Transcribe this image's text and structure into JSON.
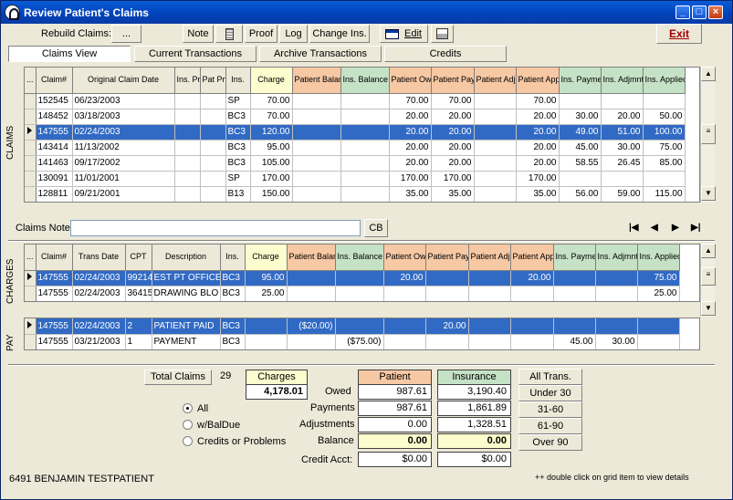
{
  "window": {
    "title": "Review Patient's Claims"
  },
  "toolbar": {
    "rebuild_label": "Rebuild Claims:",
    "rebuild_button": "...",
    "note": "Note",
    "proof": "Proof",
    "log": "Log",
    "change_ins": "Change Ins.",
    "edit": "Edit",
    "exit": "Exit"
  },
  "tabs": [
    "Claims View",
    "Current Transactions",
    "Archive Transactions",
    "Credits"
  ],
  "side_labels": {
    "claims": "CLAIMS",
    "charges": "CHARGES",
    "pay": "PAY"
  },
  "claims": {
    "headers": [
      "...",
      "Claim#",
      "Original Claim Date",
      "Ins. Prf",
      "Pat Prf",
      "Ins.",
      "Charge",
      "Patient Balance",
      "Ins. Balance",
      "Patient Owed",
      "Patient Payment",
      "Patient Adjmnt",
      "Patient Applied",
      "Ins. Payment",
      "Ins. Adjmnt",
      "Ins. Applied"
    ],
    "rows": [
      [
        "",
        "152545",
        "06/23/2003",
        "",
        "",
        "SP",
        "70.00",
        "",
        "",
        "70.00",
        "70.00",
        "",
        "70.00",
        "",
        "",
        ""
      ],
      [
        "",
        "148452",
        "03/18/2003",
        "",
        "",
        "BC3",
        "70.00",
        "",
        "",
        "20.00",
        "20.00",
        "",
        "20.00",
        "30.00",
        "20.00",
        "50.00"
      ],
      [
        "sel",
        "147555",
        "02/24/2003",
        "",
        "",
        "BC3",
        "120.00",
        "",
        "",
        "20.00",
        "20.00",
        "",
        "20.00",
        "49.00",
        "51.00",
        "100.00"
      ],
      [
        "",
        "143414",
        "11/13/2002",
        "",
        "",
        "BC3",
        "95.00",
        "",
        "",
        "20.00",
        "20.00",
        "",
        "20.00",
        "45.00",
        "30.00",
        "75.00"
      ],
      [
        "",
        "141463",
        "09/17/2002",
        "",
        "",
        "BC3",
        "105.00",
        "",
        "",
        "20.00",
        "20.00",
        "",
        "20.00",
        "58.55",
        "26.45",
        "85.00"
      ],
      [
        "",
        "130091",
        "11/01/2001",
        "",
        "",
        "SP",
        "170.00",
        "",
        "",
        "170.00",
        "170.00",
        "",
        "170.00",
        "",
        "",
        ""
      ],
      [
        "",
        "128811",
        "09/21/2001",
        "",
        "",
        "B13",
        "150.00",
        "",
        "",
        "35.00",
        "35.00",
        "",
        "35.00",
        "56.00",
        "59.00",
        "115.00"
      ]
    ],
    "note_label": "Claims Note:",
    "note_value": "",
    "cb": "CB"
  },
  "charges": {
    "headers": [
      "...",
      "Claim#",
      "Trans Date",
      "CPT",
      "Description",
      "Ins.",
      "Charge",
      "Patient Balance",
      "Ins. Balance",
      "Patient Owed",
      "Patient Payment",
      "Patient Adjmnt",
      "Patient Applied",
      "Ins. Payment",
      "Ins. Adjmnt",
      "Ins. Applied"
    ],
    "rows": [
      [
        "sel",
        "147555",
        "02/24/2003",
        "99214",
        "EST PT OFFICE",
        "BC3",
        "95.00",
        "",
        "",
        "20.00",
        "",
        "",
        "20.00",
        "",
        "",
        "75.00"
      ],
      [
        "",
        "147555",
        "02/24/2003",
        "36415",
        "DRAWING BLO",
        "BC3",
        "25.00",
        "",
        "",
        "",
        "",
        "",
        "",
        "",
        "",
        "25.00"
      ]
    ]
  },
  "pay": {
    "rows": [
      [
        "sel",
        "147555",
        "02/24/2003",
        "2",
        "PATIENT PAID",
        "BC3",
        "",
        "($20.00)",
        "",
        "",
        "20.00",
        "",
        "",
        "",
        "",
        ""
      ],
      [
        "",
        "147555",
        "03/21/2003",
        "1",
        "PAYMENT",
        "BC3",
        "",
        "",
        "($75.00)",
        "",
        "",
        "",
        "",
        "45.00",
        "30.00",
        ""
      ]
    ]
  },
  "summary": {
    "total_claims_label": "Total Claims",
    "total_claims": "29",
    "charges_label": "Charges",
    "charges_value": "4,178.01",
    "radios": [
      "All",
      "w/BalDue",
      "Credits or Problems"
    ],
    "row_labels": [
      "Owed",
      "Payments",
      "Adjustments",
      "Balance",
      "Credit Acct:"
    ],
    "patient_label": "Patient",
    "insurance_label": "Insurance",
    "patient": [
      "987.61",
      "987.61",
      "0.00",
      "0.00",
      "$0.00"
    ],
    "insurance": [
      "3,190.40",
      "1,861.89",
      "1,328.51",
      "0.00",
      "$0.00"
    ],
    "filters": [
      "All Trans.",
      "Under 30",
      "31-60",
      "61-90",
      "Over 90"
    ]
  },
  "status": {
    "patient": "6491  BENJAMIN TESTPATIENT",
    "hint": "++ double click on grid item to view details"
  },
  "colors": {
    "title": "#0a4cc4",
    "selected": "#316ac5",
    "patient_header": "#f7c8a4",
    "ins_header": "#c6e2c6",
    "charge_header": "#fdfccf"
  }
}
